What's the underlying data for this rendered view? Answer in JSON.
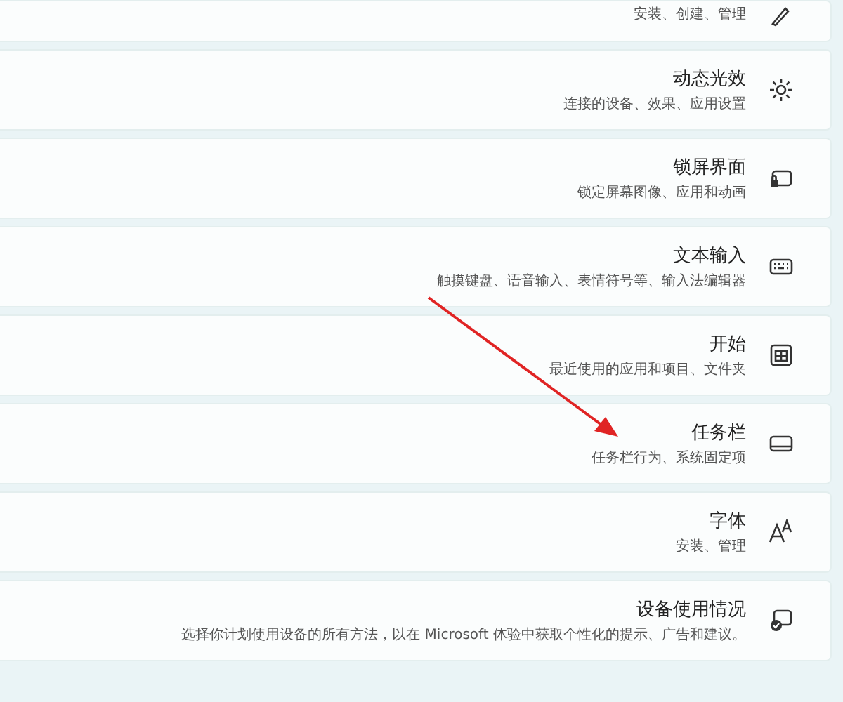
{
  "settings_items": [
    {
      "subtitle": "安装、创建、管理"
    },
    {
      "title": "动态光效",
      "subtitle": "连接的设备、效果、应用设置"
    },
    {
      "title": "锁屏界面",
      "subtitle": "锁定屏幕图像、应用和动画"
    },
    {
      "title": "文本输入",
      "subtitle": "触摸键盘、语音输入、表情符号等、输入法编辑器"
    },
    {
      "title": "开始",
      "subtitle": "最近使用的应用和项目、文件夹"
    },
    {
      "title": "任务栏",
      "subtitle": "任务栏行为、系统固定项"
    },
    {
      "title": "字体",
      "subtitle": "安装、管理"
    },
    {
      "title": "设备使用情况",
      "subtitle": "选择你计划使用设备的所有方法，以在 Microsoft 体验中获取个性化的提示、广告和建议。"
    }
  ],
  "annotations": [
    {
      "kind": "arrow"
    }
  ]
}
